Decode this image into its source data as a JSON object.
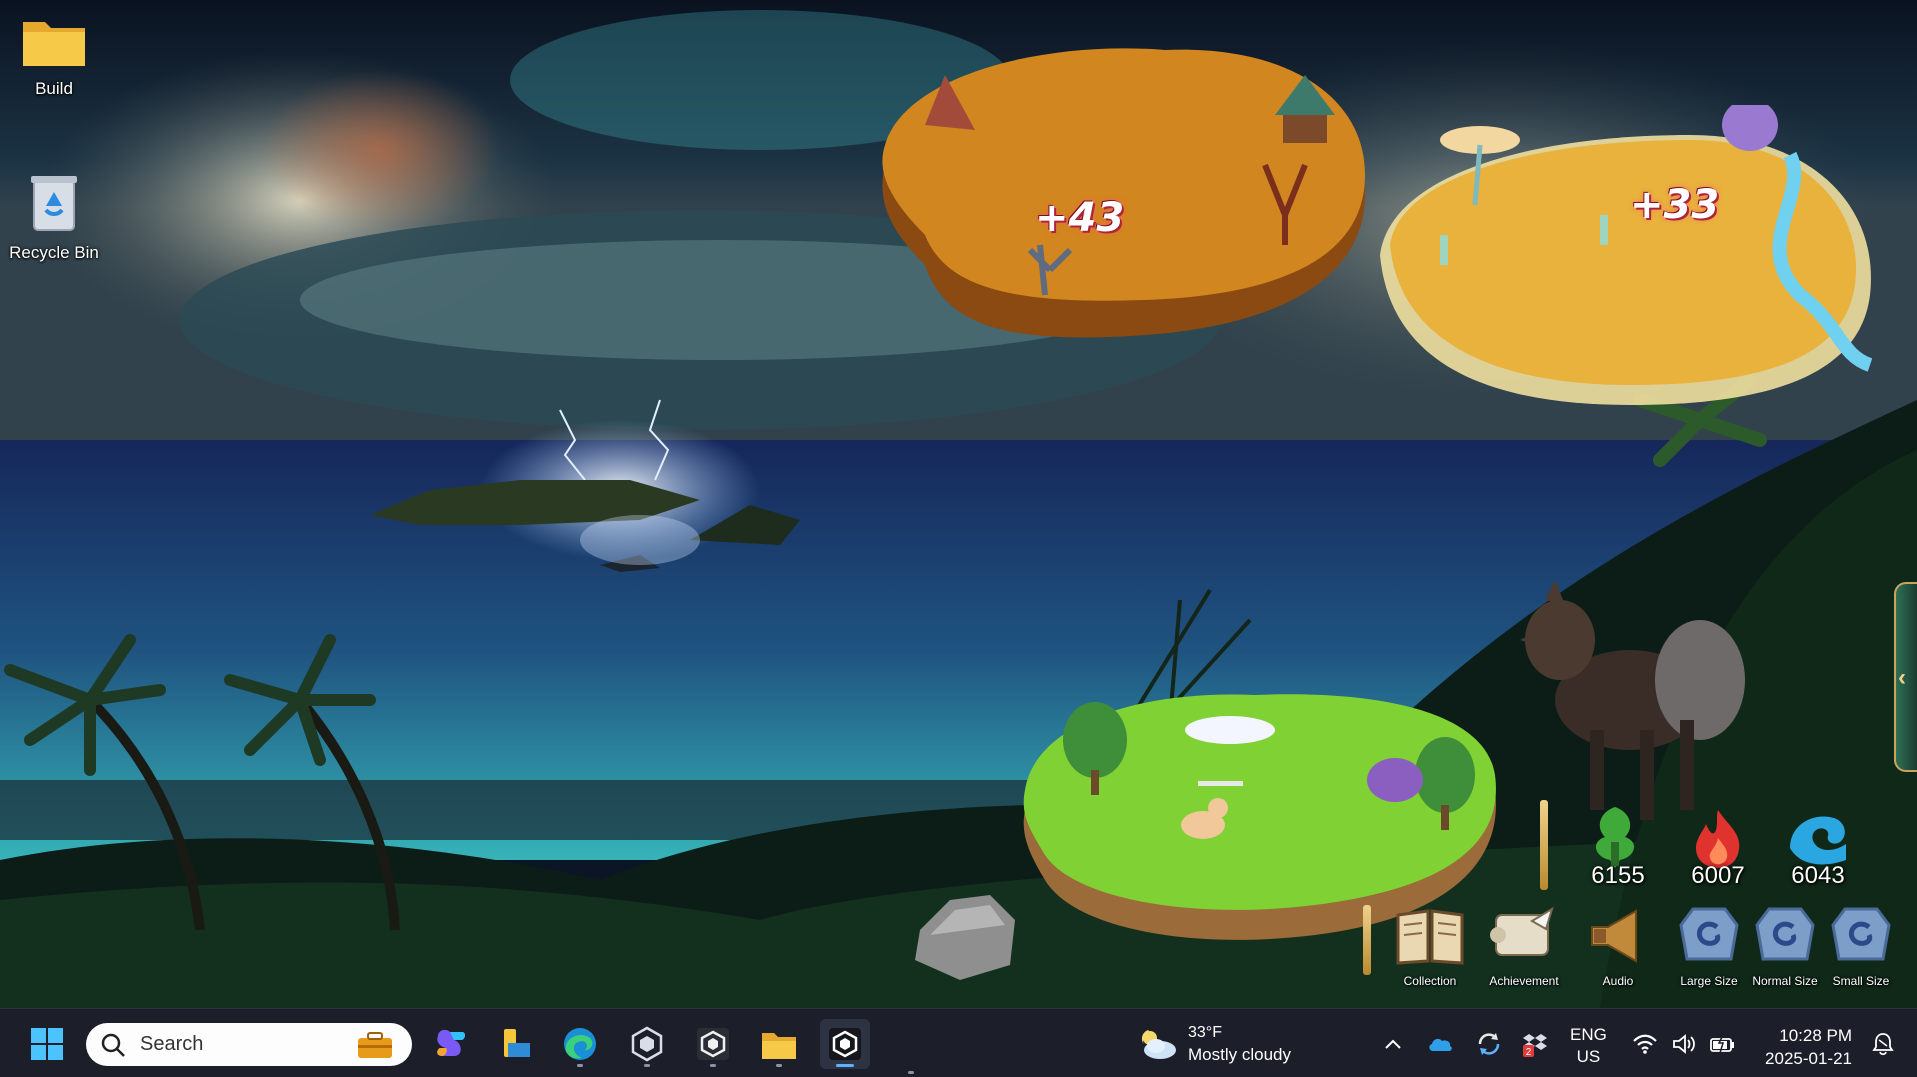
{
  "desktop": {
    "icons": [
      {
        "label": "Build"
      },
      {
        "label": "Recycle Bin"
      }
    ]
  },
  "islands": {
    "autumn_gain": "+43",
    "desert_gain": "+33"
  },
  "resources": {
    "earth": "6155",
    "fire": "6007",
    "water": "6043"
  },
  "hud_buttons": {
    "collection": "Collection",
    "achievement": "Achievement",
    "audio": "Audio",
    "large_size": "Large Size",
    "normal_size": "Normal Size",
    "small_size": "Small Size"
  },
  "taskbar": {
    "search_placeholder": "Search",
    "weather_temp": "33°F",
    "weather_condition": "Mostly cloudy",
    "language_line1": "ENG",
    "language_line2": "US",
    "time": "10:28 PM",
    "date": "2025-01-21",
    "notification_badge": "2"
  },
  "colors": {
    "taskbar_bg": "#1c1f2a",
    "active_indicator": "#5fb0ff",
    "gain_text_glow": "#b0213a",
    "hud_gold": "#c9a55c"
  }
}
